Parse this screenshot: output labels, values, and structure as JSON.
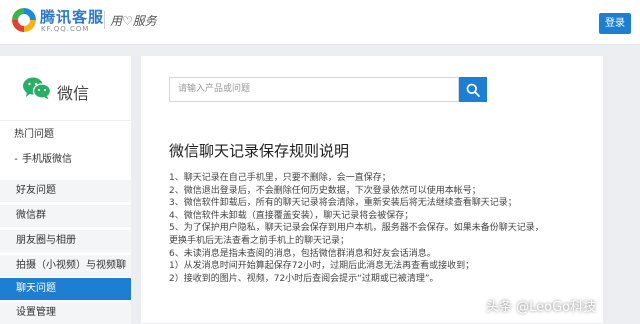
{
  "header": {
    "brand_name": "腾讯客服",
    "brand_url": "KF.QQ.COM",
    "slogan": "用♡服务",
    "login_label": "登录"
  },
  "sidebar": {
    "app_name": "微信",
    "items": [
      {
        "label": "热门问题"
      },
      {
        "label": "手机版微信"
      },
      {
        "label": "好友问题"
      },
      {
        "label": "微信群"
      },
      {
        "label": "朋友圈与相册"
      },
      {
        "label": "拍摄（小视频）与视频聊天"
      },
      {
        "label": "聊天问题"
      },
      {
        "label": "设置管理"
      }
    ]
  },
  "search": {
    "placeholder": "请输入产品或问题"
  },
  "article": {
    "title": "微信聊天记录保存规则说明",
    "lines": [
      "1、聊天记录在自己手机里，只要不删除，会一直保存；",
      "2、微信退出登录后，不会删除任何历史数据，下次登录依然可以使用本帐号；",
      "3、微信软件卸载后，所有的聊天记录将会清除，重新安装后将无法继续查看聊天记录；",
      "4、微信软件未卸载（直接覆盖安装），聊天记录将会被保存；",
      "5、为了保护用户隐私，聊天记录会保存到用户本机，服务器不会保存。如果未备份聊天记录，",
      "更换手机后无法查看之前手机上的聊天记录；",
      "6、未读消息是指未查阅的消息，包括微信群消息和好友会话消息。",
      "1）从发消息时间开始算起保存72小时，过期后此消息无法再查看或接收到；",
      "2）接收到的图片、视频，72小时后查阅会提示“过期或已被清理”。"
    ]
  },
  "watermark": "头条 @LeoGo科技",
  "colors": {
    "accent": "#1e7fd2",
    "background": "#eceef1",
    "wechat_green": "#2aae67"
  }
}
